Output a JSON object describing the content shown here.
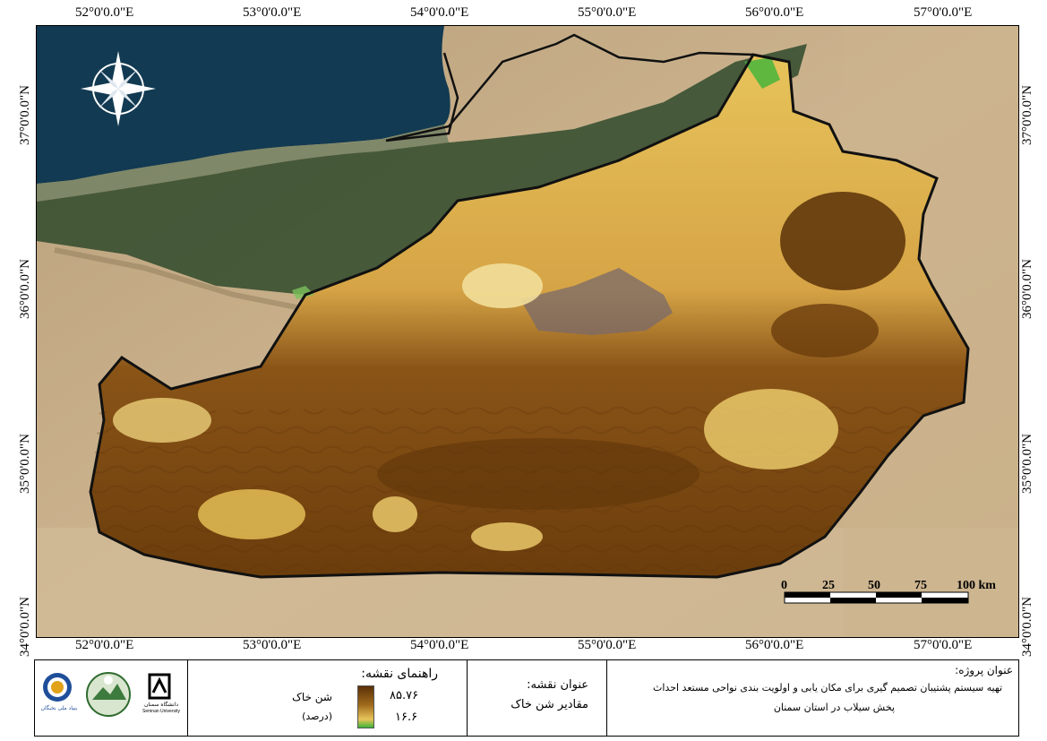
{
  "map": {
    "top_longitudes": [
      "52°0'0.0\"E",
      "53°0'0.0\"E",
      "54°0'0.0\"E",
      "55°0'0.0\"E",
      "56°0'0.0\"E",
      "57°0'0.0\"E"
    ],
    "bottom_longitudes": [
      "52°0'0.0\"E",
      "53°0'0.0\"E",
      "54°0'0.0\"E",
      "55°0'0.0\"E",
      "56°0'0.0\"E",
      "57°0'0.0\"E"
    ],
    "left_latitudes": [
      "37°0'0.0\"N",
      "36°0'0.0\"N",
      "35°0'0.0\"N",
      "34°0'0.0\"N"
    ],
    "right_latitudes": [
      "37°0'0.0\"N",
      "36°0'0.0\"N",
      "35°0'0.0\"N",
      "34°0'0.0\"N"
    ],
    "scale_bar": {
      "labels": [
        "0",
        "25",
        "50",
        "75",
        "100 km"
      ]
    },
    "north_arrow": "compass-rose-icon"
  },
  "colors": {
    "sea": "#123a52",
    "terrain_light": "#cdb48f",
    "terrain_mid": "#b79a70",
    "forest": "#2f4a2c",
    "raster_high": "#5a3108",
    "raster_mid": "#a06a1c",
    "raster_low": "#e8c45a",
    "raster_min": "#3db43a",
    "boundary": "#111111"
  },
  "legend_panel": {
    "title": "راهنمای نقشه:",
    "layer_name": "شن خاک",
    "unit": "(درصد)",
    "max_value": "۸۵.۷۶",
    "min_value": "۱۶.۶"
  },
  "map_title_panel": {
    "heading": "عنوان نقشه:",
    "value": "مقادیر شن خاک"
  },
  "project_panel": {
    "heading": "عنوان پروژه:",
    "line1": "تهیه سیستم پشتیبان تصمیم گیری برای مکان یابی و اولویت بندی نواحی مستعد احداث",
    "line2": "پخش سیلاب در استان سمنان"
  },
  "logos": {
    "semnan_university": "دانشگاه سمنان",
    "semnan_university_en": "Semnan University",
    "nokhbegan": "بنیاد ملی نخبگان"
  }
}
